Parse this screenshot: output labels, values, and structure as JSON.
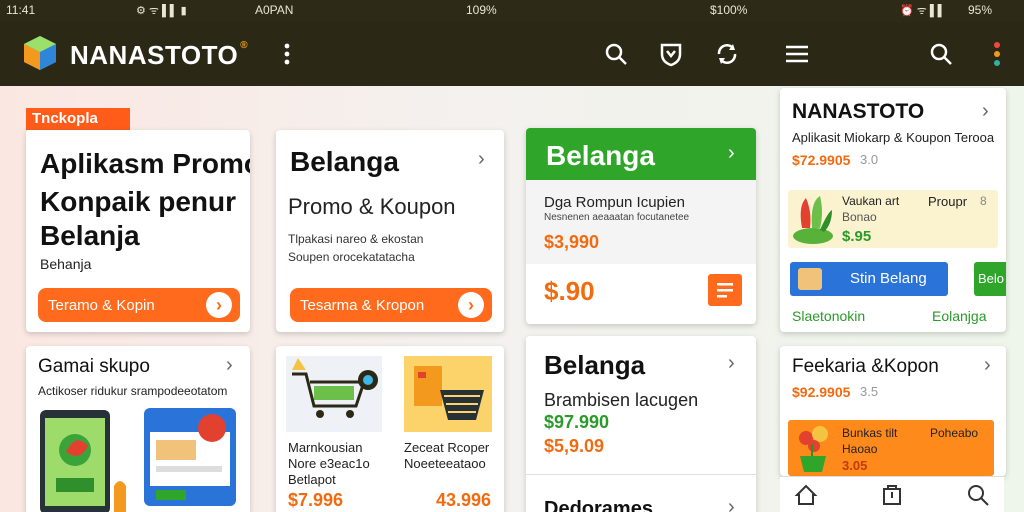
{
  "status_bar": {
    "left_time": "11:41",
    "carrier": "A0PAN",
    "battery_a": "109%",
    "battery_b": "$100%",
    "right_icons": "95%"
  },
  "app_bar": {
    "title": "NANASTOTO",
    "title_mark": "®"
  },
  "tag_label": "Tnckopla",
  "card_promo": {
    "line1": "Aplikasm Promo",
    "line2": "Konpaik penur",
    "line3": "Belanja",
    "sub": "Behanja",
    "button": "Teramo & Kopin"
  },
  "card_belanga1": {
    "title": "Belanga",
    "sub": "Promo & Koupon",
    "desc1": "Tlpakasi nareo & ekostan",
    "desc2": "Soupen orocekatatacha",
    "button": "Tesarma & Kropon"
  },
  "card_green": {
    "title": "Belanga",
    "desc1": "Dga Rompun Icupien",
    "desc2": "Nesnenen aeaaatan focutanetee",
    "price1": "$3,990",
    "price2": "$.90"
  },
  "card_right_top": {
    "title": "NANASTOTO",
    "sub": "Aplikasit Miokarp & Koupon Terooa",
    "price": "$72.9905",
    "price_suffix": "3.0",
    "item_name": "Vaukan art",
    "item_sub": "Bonao",
    "item_tag": "Proupr",
    "item_tag2": "8",
    "item_price": "$.95",
    "blue_button": "Stin Belang",
    "green_button": "Belo",
    "footer_left": "Slaetonokin",
    "footer_right": "Eolanjga"
  },
  "card_bottom1": {
    "title": "Gamai skupo",
    "sub": "Actikoser ridukur srampodeeotatom"
  },
  "card_bottom2": {
    "item1_line1": "Marnkousian",
    "item1_line2": "Nore e3eac1o",
    "item1_line3": "Betlapot",
    "item1_price": "$7.996",
    "item2_line1": "Zeceat Rcoper",
    "item2_line2": "Noeeteeataoo",
    "item2_price": "43.996"
  },
  "card_bottom3": {
    "title": "Belanga",
    "sub": "Brambisen lacugen",
    "price_green": "$97.990",
    "price_orange": "$5,9.09",
    "next_title": "Dedorames"
  },
  "card_bottom4": {
    "title": "Feekaria &Kopon",
    "price": "$92.9905",
    "price_suffix": "3.5",
    "item_name": "Bunkas tilt",
    "item_sub": "Haoao",
    "item_tag": "Poheabo",
    "item_price": "3.05"
  },
  "colors": {
    "accent_orange": "#ff6a1c",
    "accent_green": "#2fa52a",
    "appbar": "#2b2816"
  }
}
